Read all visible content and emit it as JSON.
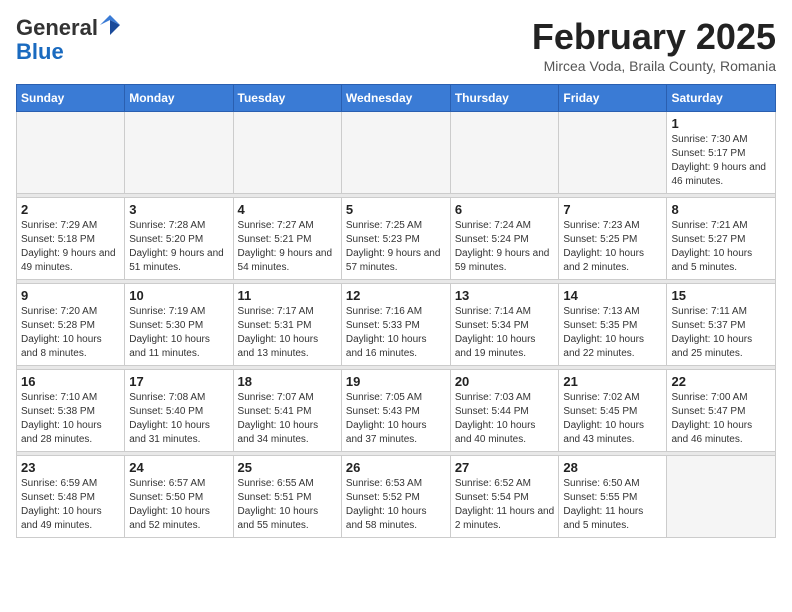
{
  "header": {
    "logo_general": "General",
    "logo_blue": "Blue",
    "month_title": "February 2025",
    "location": "Mircea Voda, Braila County, Romania"
  },
  "calendar": {
    "days_of_week": [
      "Sunday",
      "Monday",
      "Tuesday",
      "Wednesday",
      "Thursday",
      "Friday",
      "Saturday"
    ],
    "weeks": [
      [
        {
          "day": "",
          "info": ""
        },
        {
          "day": "",
          "info": ""
        },
        {
          "day": "",
          "info": ""
        },
        {
          "day": "",
          "info": ""
        },
        {
          "day": "",
          "info": ""
        },
        {
          "day": "",
          "info": ""
        },
        {
          "day": "1",
          "info": "Sunrise: 7:30 AM\nSunset: 5:17 PM\nDaylight: 9 hours and 46 minutes."
        }
      ],
      [
        {
          "day": "2",
          "info": "Sunrise: 7:29 AM\nSunset: 5:18 PM\nDaylight: 9 hours and 49 minutes."
        },
        {
          "day": "3",
          "info": "Sunrise: 7:28 AM\nSunset: 5:20 PM\nDaylight: 9 hours and 51 minutes."
        },
        {
          "day": "4",
          "info": "Sunrise: 7:27 AM\nSunset: 5:21 PM\nDaylight: 9 hours and 54 minutes."
        },
        {
          "day": "5",
          "info": "Sunrise: 7:25 AM\nSunset: 5:23 PM\nDaylight: 9 hours and 57 minutes."
        },
        {
          "day": "6",
          "info": "Sunrise: 7:24 AM\nSunset: 5:24 PM\nDaylight: 9 hours and 59 minutes."
        },
        {
          "day": "7",
          "info": "Sunrise: 7:23 AM\nSunset: 5:25 PM\nDaylight: 10 hours and 2 minutes."
        },
        {
          "day": "8",
          "info": "Sunrise: 7:21 AM\nSunset: 5:27 PM\nDaylight: 10 hours and 5 minutes."
        }
      ],
      [
        {
          "day": "9",
          "info": "Sunrise: 7:20 AM\nSunset: 5:28 PM\nDaylight: 10 hours and 8 minutes."
        },
        {
          "day": "10",
          "info": "Sunrise: 7:19 AM\nSunset: 5:30 PM\nDaylight: 10 hours and 11 minutes."
        },
        {
          "day": "11",
          "info": "Sunrise: 7:17 AM\nSunset: 5:31 PM\nDaylight: 10 hours and 13 minutes."
        },
        {
          "day": "12",
          "info": "Sunrise: 7:16 AM\nSunset: 5:33 PM\nDaylight: 10 hours and 16 minutes."
        },
        {
          "day": "13",
          "info": "Sunrise: 7:14 AM\nSunset: 5:34 PM\nDaylight: 10 hours and 19 minutes."
        },
        {
          "day": "14",
          "info": "Sunrise: 7:13 AM\nSunset: 5:35 PM\nDaylight: 10 hours and 22 minutes."
        },
        {
          "day": "15",
          "info": "Sunrise: 7:11 AM\nSunset: 5:37 PM\nDaylight: 10 hours and 25 minutes."
        }
      ],
      [
        {
          "day": "16",
          "info": "Sunrise: 7:10 AM\nSunset: 5:38 PM\nDaylight: 10 hours and 28 minutes."
        },
        {
          "day": "17",
          "info": "Sunrise: 7:08 AM\nSunset: 5:40 PM\nDaylight: 10 hours and 31 minutes."
        },
        {
          "day": "18",
          "info": "Sunrise: 7:07 AM\nSunset: 5:41 PM\nDaylight: 10 hours and 34 minutes."
        },
        {
          "day": "19",
          "info": "Sunrise: 7:05 AM\nSunset: 5:43 PM\nDaylight: 10 hours and 37 minutes."
        },
        {
          "day": "20",
          "info": "Sunrise: 7:03 AM\nSunset: 5:44 PM\nDaylight: 10 hours and 40 minutes."
        },
        {
          "day": "21",
          "info": "Sunrise: 7:02 AM\nSunset: 5:45 PM\nDaylight: 10 hours and 43 minutes."
        },
        {
          "day": "22",
          "info": "Sunrise: 7:00 AM\nSunset: 5:47 PM\nDaylight: 10 hours and 46 minutes."
        }
      ],
      [
        {
          "day": "23",
          "info": "Sunrise: 6:59 AM\nSunset: 5:48 PM\nDaylight: 10 hours and 49 minutes."
        },
        {
          "day": "24",
          "info": "Sunrise: 6:57 AM\nSunset: 5:50 PM\nDaylight: 10 hours and 52 minutes."
        },
        {
          "day": "25",
          "info": "Sunrise: 6:55 AM\nSunset: 5:51 PM\nDaylight: 10 hours and 55 minutes."
        },
        {
          "day": "26",
          "info": "Sunrise: 6:53 AM\nSunset: 5:52 PM\nDaylight: 10 hours and 58 minutes."
        },
        {
          "day": "27",
          "info": "Sunrise: 6:52 AM\nSunset: 5:54 PM\nDaylight: 11 hours and 2 minutes."
        },
        {
          "day": "28",
          "info": "Sunrise: 6:50 AM\nSunset: 5:55 PM\nDaylight: 11 hours and 5 minutes."
        },
        {
          "day": "",
          "info": ""
        }
      ]
    ]
  }
}
